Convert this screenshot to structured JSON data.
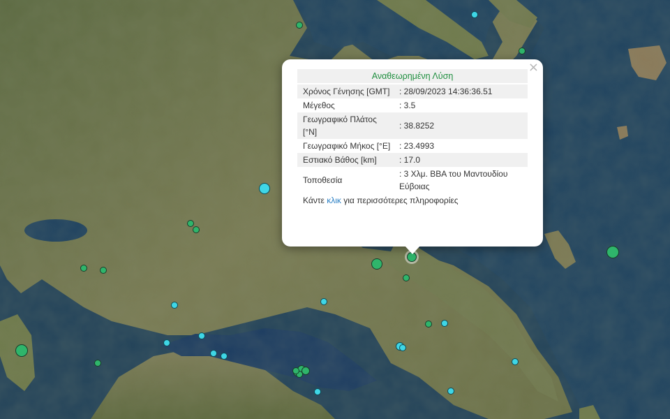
{
  "popup": {
    "title": "Αναθεωρημένη Λύση",
    "close": "×",
    "rows": [
      {
        "label": "Χρόνος Γένησης [GMT]",
        "value": ": 28/09/2023 14:36:36.51"
      },
      {
        "label": "Μέγεθος",
        "value": ": 3.5"
      },
      {
        "label": "Γεωγραφικό Πλάτος [°N]",
        "value": ": 38.8252"
      },
      {
        "label": "Γεωγραφικό Μήκος [°E]",
        "value": ": 23.4993"
      },
      {
        "label": "Εστιακό Βάθος [km]",
        "value": ": 17.0"
      },
      {
        "label": "Τοποθεσία",
        "value": ": 3 Χλμ. ΒΒΑ του Μαντουδίου Εύβοιας"
      }
    ],
    "more_prefix": "Κάντε",
    "more_link": "κλικ",
    "more_suffix": "για περισσότερες πληροφορίες"
  },
  "colors": {
    "sea": "#23435a",
    "land": "#6e7a4e",
    "marker_green": "#2fb56b",
    "marker_cyan": "#3fd6e6",
    "popup_title": "#1e8e3e",
    "link": "#2a7fc4"
  },
  "icons": [
    "close-icon"
  ]
}
